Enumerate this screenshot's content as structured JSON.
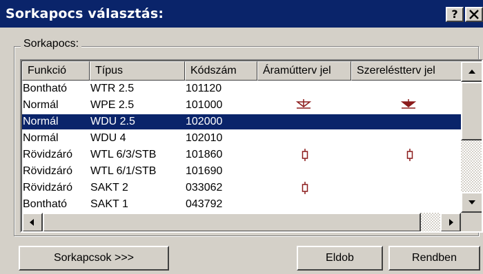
{
  "window": {
    "title": "Sorkapocs választás:",
    "help_label": "?",
    "close_label": "✕"
  },
  "group": {
    "label": "Sorkapocs:"
  },
  "table": {
    "columns": [
      "Funkció",
      "Típus",
      "Kódszám",
      "Áramútterv jel",
      "Szereléstterv jel"
    ],
    "rows": [
      {
        "funkcio": "Bontható",
        "tipus": "WTR 2.5",
        "kodszam": "101120",
        "aramutterv_jel": "",
        "szerelesterv_jel": "",
        "selected": false
      },
      {
        "funkcio": "Normál",
        "tipus": "WPE 2.5",
        "kodszam": "101000",
        "aramutterv_jel": "ground-outline-symbol",
        "szerelesterv_jel": "ground-filled-symbol",
        "selected": false
      },
      {
        "funkcio": "Normál",
        "tipus": "WDU 2.5",
        "kodszam": "102000",
        "aramutterv_jel": "",
        "szerelesterv_jel": "",
        "selected": true
      },
      {
        "funkcio": "Normál",
        "tipus": "WDU 4",
        "kodszam": "102010",
        "aramutterv_jel": "",
        "szerelesterv_jel": "",
        "selected": false
      },
      {
        "funkcio": "Rövidzáró",
        "tipus": "WTL 6/3/STB",
        "kodszam": "101860",
        "aramutterv_jel": "terminal-symbol",
        "szerelesterv_jel": "terminal-symbol",
        "selected": false
      },
      {
        "funkcio": "Rövidzáró",
        "tipus": "WTL 6/1/STB",
        "kodszam": "101690",
        "aramutterv_jel": "",
        "szerelesterv_jel": "",
        "selected": false
      },
      {
        "funkcio": "Rövidzáró",
        "tipus": "SAKT 2",
        "kodszam": "033062",
        "aramutterv_jel": "terminal-symbol",
        "szerelesterv_jel": "",
        "selected": false
      },
      {
        "funkcio": "Bontható",
        "tipus": "SAKT 1",
        "kodszam": "043792",
        "aramutterv_jel": "",
        "szerelesterv_jel": "",
        "selected": false
      }
    ]
  },
  "buttons": {
    "sorkapcsok": "Sorkapcsok >>>",
    "eldob": "Eldob",
    "rendben": "Rendben"
  },
  "colors": {
    "titlebar": "#0a246a",
    "selection": "#0a246a",
    "symbol": "#8b1a1a",
    "face": "#d4d0c8"
  }
}
